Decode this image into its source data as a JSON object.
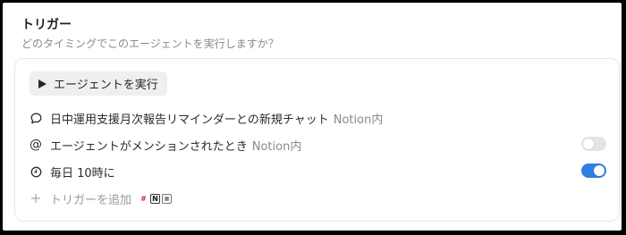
{
  "header": {
    "title": "トリガー",
    "subtitle": "どのタイミングでこのエージェントを実行しますか？"
  },
  "run_button": {
    "label": "エージェントを実行",
    "icon": "play-icon"
  },
  "triggers": [
    {
      "icon": "chat-bubble-icon",
      "label": "日中運用支援月次報告リマインダーとの新規チャット",
      "suffix": "Notion内"
    },
    {
      "icon": "at-sign-icon",
      "label": "エージェントがメンションされたとき",
      "suffix": "Notion内",
      "enabled": false
    },
    {
      "icon": "clock-icon",
      "label": "毎日 10時に",
      "enabled": true
    }
  ],
  "add_trigger": {
    "label": "トリガーを追加",
    "icons": [
      "slack-icon",
      "notion-icon",
      "calendar-icon"
    ]
  },
  "colors": {
    "toggle_on": "#2f80e2",
    "toggle_off": "#e4e4e4"
  }
}
